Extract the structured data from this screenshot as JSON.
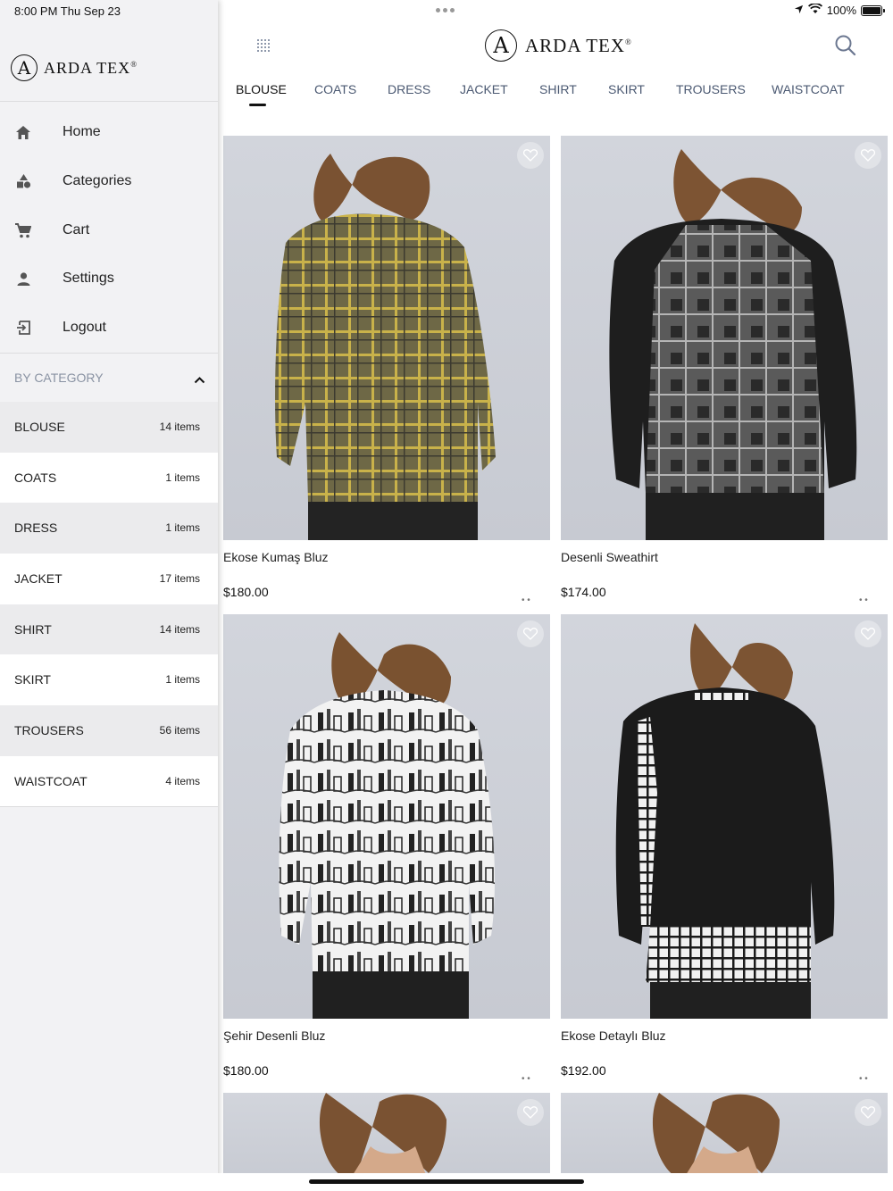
{
  "status_bar": {
    "time": "8:00 PM  Thu Sep 23",
    "battery": "100%"
  },
  "brand": {
    "name": "ARDA TEX",
    "mark": "A",
    "registered": "®"
  },
  "drawer": {
    "menu": [
      {
        "label": "Home",
        "icon": "home-icon"
      },
      {
        "label": "Categories",
        "icon": "categories-icon"
      },
      {
        "label": "Cart",
        "icon": "cart-icon"
      },
      {
        "label": "Settings",
        "icon": "person-icon"
      },
      {
        "label": "Logout",
        "icon": "logout-icon"
      }
    ],
    "by_category_label": "BY CATEGORY",
    "categories": [
      {
        "name": "BLOUSE",
        "count": "14 items"
      },
      {
        "name": "COATS",
        "count": "1 items"
      },
      {
        "name": "DRESS",
        "count": "1 items"
      },
      {
        "name": "JACKET",
        "count": "17 items"
      },
      {
        "name": "SHIRT",
        "count": "14 items"
      },
      {
        "name": "SKIRT",
        "count": "1 items"
      },
      {
        "name": "TROUSERS",
        "count": "56 items"
      },
      {
        "name": "WAISTCOAT",
        "count": "4 items"
      }
    ]
  },
  "tabs": [
    "BLOUSE",
    "COATS",
    "DRESS",
    "JACKET",
    "SHIRT",
    "SKIRT",
    "TROUSERS",
    "WAISTCOAT"
  ],
  "active_tab": "BLOUSE",
  "products": [
    {
      "title": "Ekose Kumaş Bluz",
      "price": "$180.00",
      "image": "plaid-olive-blouse"
    },
    {
      "title": "Desenli Sweathirt",
      "price": "$174.00",
      "image": "grey-check-sweatshirt"
    },
    {
      "title": "Şehir Desenli Bluz",
      "price": "$180.00",
      "image": "city-print-blouse"
    },
    {
      "title": "Ekose Detaylı Bluz",
      "price": "$192.00",
      "image": "black-check-detail-blouse"
    },
    {
      "title": "",
      "price": "",
      "image": "partial-card"
    },
    {
      "title": "",
      "price": "",
      "image": "partial-card"
    }
  ],
  "colors": {
    "tab_text": "#4b5972",
    "drawer_bg": "#f2f2f4",
    "category_label": "#8a93a3"
  }
}
